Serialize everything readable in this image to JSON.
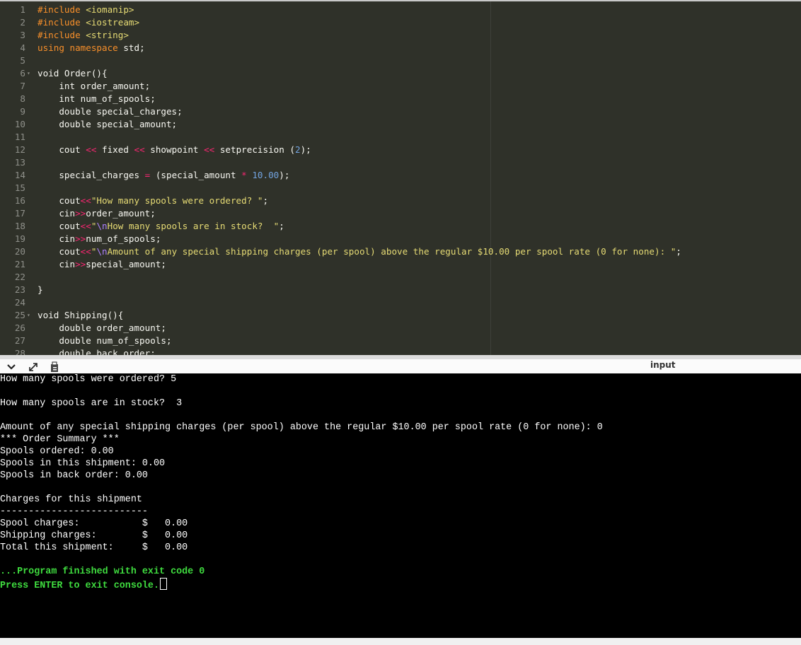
{
  "editor": {
    "lines": [
      {
        "n": "1",
        "fold": false,
        "tokens": [
          [
            "dir",
            "#include "
          ],
          [
            "inc",
            "<iomanip>"
          ]
        ]
      },
      {
        "n": "2",
        "fold": false,
        "tokens": [
          [
            "dir",
            "#include "
          ],
          [
            "inc",
            "<iostream>"
          ]
        ]
      },
      {
        "n": "3",
        "fold": false,
        "tokens": [
          [
            "dir",
            "#include "
          ],
          [
            "inc",
            "<string>"
          ]
        ]
      },
      {
        "n": "4",
        "fold": false,
        "tokens": [
          [
            "kw",
            "using namespace "
          ],
          [
            "id",
            "std;"
          ]
        ]
      },
      {
        "n": "5",
        "fold": false,
        "tokens": []
      },
      {
        "n": "6",
        "fold": true,
        "tokens": [
          [
            "id",
            "void Order(){"
          ]
        ]
      },
      {
        "n": "7",
        "fold": false,
        "tokens": [
          [
            "id",
            "    int order_amount;"
          ]
        ]
      },
      {
        "n": "8",
        "fold": false,
        "tokens": [
          [
            "id",
            "    int num_of_spools;"
          ]
        ]
      },
      {
        "n": "9",
        "fold": false,
        "tokens": [
          [
            "id",
            "    double special_charges;"
          ]
        ]
      },
      {
        "n": "10",
        "fold": false,
        "tokens": [
          [
            "id",
            "    double special_amount;"
          ]
        ]
      },
      {
        "n": "11",
        "fold": false,
        "tokens": []
      },
      {
        "n": "12",
        "fold": false,
        "tokens": [
          [
            "id",
            "    cout "
          ],
          [
            "op",
            "<<"
          ],
          [
            "id",
            " fixed "
          ],
          [
            "op",
            "<<"
          ],
          [
            "id",
            " showpoint "
          ],
          [
            "op",
            "<<"
          ],
          [
            "id",
            " setprecision ("
          ],
          [
            "num",
            "2"
          ],
          [
            "id",
            ");"
          ]
        ]
      },
      {
        "n": "13",
        "fold": false,
        "tokens": []
      },
      {
        "n": "14",
        "fold": false,
        "tokens": [
          [
            "id",
            "    special_charges "
          ],
          [
            "op",
            "="
          ],
          [
            "id",
            " (special_amount "
          ],
          [
            "op",
            "*"
          ],
          [
            "id",
            " "
          ],
          [
            "num",
            "10.00"
          ],
          [
            "id",
            ");"
          ]
        ]
      },
      {
        "n": "15",
        "fold": false,
        "tokens": []
      },
      {
        "n": "16",
        "fold": false,
        "tokens": [
          [
            "id",
            "    cout"
          ],
          [
            "op",
            "<<"
          ],
          [
            "str",
            "\"How many spools were ordered? \""
          ],
          [
            "id",
            ";"
          ]
        ]
      },
      {
        "n": "17",
        "fold": false,
        "tokens": [
          [
            "id",
            "    cin"
          ],
          [
            "op",
            ">>"
          ],
          [
            "id",
            "order_amount;"
          ]
        ]
      },
      {
        "n": "18",
        "fold": false,
        "tokens": [
          [
            "id",
            "    cout"
          ],
          [
            "op",
            "<<"
          ],
          [
            "str",
            "\""
          ],
          [
            "esc",
            "\\n"
          ],
          [
            "str",
            "How many spools are in stock?  \""
          ],
          [
            "id",
            ";"
          ]
        ]
      },
      {
        "n": "19",
        "fold": false,
        "tokens": [
          [
            "id",
            "    cin"
          ],
          [
            "op",
            ">>"
          ],
          [
            "id",
            "num_of_spools;"
          ]
        ]
      },
      {
        "n": "20",
        "fold": false,
        "tokens": [
          [
            "id",
            "    cout"
          ],
          [
            "op",
            "<<"
          ],
          [
            "str",
            "\""
          ],
          [
            "esc",
            "\\n"
          ],
          [
            "str",
            "Amount of any special shipping charges (per spool) above the regular $10.00 per spool rate (0 for none): \""
          ],
          [
            "id",
            ";"
          ]
        ]
      },
      {
        "n": "21",
        "fold": false,
        "tokens": [
          [
            "id",
            "    cin"
          ],
          [
            "op",
            ">>"
          ],
          [
            "id",
            "special_amount;"
          ]
        ]
      },
      {
        "n": "22",
        "fold": false,
        "tokens": []
      },
      {
        "n": "23",
        "fold": false,
        "tokens": [
          [
            "id",
            "}"
          ]
        ]
      },
      {
        "n": "24",
        "fold": false,
        "tokens": []
      },
      {
        "n": "25",
        "fold": true,
        "tokens": [
          [
            "id",
            "void Shipping(){"
          ]
        ]
      },
      {
        "n": "26",
        "fold": false,
        "tokens": [
          [
            "id",
            "    double order_amount;"
          ]
        ]
      },
      {
        "n": "27",
        "fold": false,
        "tokens": [
          [
            "id",
            "    double num_of_spools;"
          ]
        ]
      },
      {
        "n": "28",
        "fold": false,
        "tokens": [
          [
            "id",
            "    double back_order;"
          ]
        ]
      }
    ],
    "colors": {
      "background": "#2f3129",
      "gutter_text": "#8f908a",
      "keyword": "#f9902a",
      "string": "#e6db74",
      "number": "#72a3df",
      "operator": "#f92672"
    }
  },
  "toolbar": {
    "collapse_icon": "chevron-down-icon",
    "maximize_icon": "expand-arrows-icon",
    "copy_icon": "clipboard-icon",
    "input_label": "input"
  },
  "console": {
    "lines": [
      {
        "text": "How many spools were ordered? 5",
        "style": "normal"
      },
      {
        "text": "",
        "style": "normal"
      },
      {
        "text": "How many spools are in stock?  3",
        "style": "normal"
      },
      {
        "text": "",
        "style": "normal"
      },
      {
        "text": "Amount of any special shipping charges (per spool) above the regular $10.00 per spool rate (0 for none): 0",
        "style": "normal"
      },
      {
        "text": "*** Order Summary ***",
        "style": "normal"
      },
      {
        "text": "Spools ordered: 0.00",
        "style": "normal"
      },
      {
        "text": "Spools in this shipment: 0.00",
        "style": "normal"
      },
      {
        "text": "Spools in back order: 0.00",
        "style": "normal"
      },
      {
        "text": "",
        "style": "normal"
      },
      {
        "text": "Charges for this shipment",
        "style": "normal"
      },
      {
        "text": "--------------------------",
        "style": "normal"
      },
      {
        "text": "Spool charges:           $   0.00",
        "style": "normal"
      },
      {
        "text": "Shipping charges:        $   0.00",
        "style": "normal"
      },
      {
        "text": "Total this shipment:     $   0.00",
        "style": "normal"
      },
      {
        "text": "",
        "style": "normal"
      },
      {
        "text": "...Program finished with exit code 0",
        "style": "green"
      },
      {
        "text": "Press ENTER to exit console.",
        "style": "green"
      }
    ],
    "colors": {
      "background": "#000000",
      "text": "#ffffff",
      "status": "#3fdc3f"
    }
  }
}
